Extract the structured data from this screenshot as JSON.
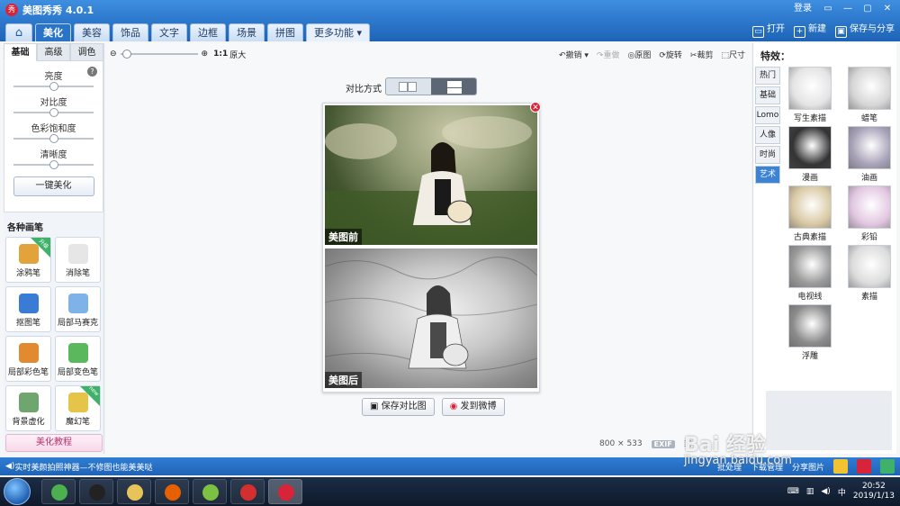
{
  "window": {
    "title": "美图秀秀 4.0.1",
    "login": "登录",
    "controls": [
      "▭",
      "—",
      "▢",
      "✕"
    ]
  },
  "tabs": [
    {
      "label": "⌂",
      "kind": "home"
    },
    {
      "label": "美化",
      "active": true
    },
    {
      "label": "美容"
    },
    {
      "label": "饰品"
    },
    {
      "label": "文字"
    },
    {
      "label": "边框"
    },
    {
      "label": "场景"
    },
    {
      "label": "拼图"
    },
    {
      "label": "更多功能 ▾"
    }
  ],
  "top_tools": {
    "open": "打开",
    "new": "新建",
    "save_share": "保存与分享"
  },
  "left": {
    "subtabs": [
      "基础",
      "高级",
      "调色"
    ],
    "sliders": [
      {
        "label": "亮度",
        "value": 0.5
      },
      {
        "label": "对比度",
        "value": 0.5
      },
      {
        "label": "色彩饱和度",
        "value": 0.5
      },
      {
        "label": "清晰度",
        "value": 0.5
      }
    ],
    "one_click": "一键美化",
    "brush_title": "各种画笔",
    "brushes": [
      {
        "label": "涂鸦笔",
        "badge": "升级",
        "color": "#e2a33a"
      },
      {
        "label": "消除笔",
        "color": "#e6e6e6"
      },
      {
        "label": "抠图笔",
        "color": "#3a7bd5"
      },
      {
        "label": "局部马赛克",
        "color": "#7fb3e8"
      },
      {
        "label": "局部彩色笔",
        "color": "#e28a2f"
      },
      {
        "label": "局部变色笔",
        "color": "#5cb85c"
      },
      {
        "label": "背景虚化",
        "color": "#6fa56f"
      },
      {
        "label": "魔幻笔",
        "badge": "new",
        "color": "#e5c44a"
      }
    ],
    "tutorial": "美化教程"
  },
  "center": {
    "zoom_1to1": "1:1",
    "zoom_original": "原大",
    "undo": "撤销",
    "redo": "重做",
    "original": "原图",
    "rotate": "旋转",
    "crop": "裁剪",
    "size": "尺寸",
    "compare_label": "对比方式",
    "before_label": "美图前",
    "after_label": "美图后",
    "save_compare": "保存对比图",
    "send_weibo": "发到微博",
    "image_width": "800",
    "image_height": "533",
    "exif": "EXIF"
  },
  "right": {
    "title": "特效：",
    "categories": [
      {
        "label": "热门"
      },
      {
        "label": "基础"
      },
      {
        "label": "Lomo"
      },
      {
        "label": "人像"
      },
      {
        "label": "时尚"
      },
      {
        "label": "艺术",
        "active": true
      }
    ],
    "effects": [
      {
        "label": "写生素描",
        "tone": "#e4e4e4"
      },
      {
        "label": "蜡笔",
        "tone": "#d6d6d6"
      },
      {
        "label": "漫画",
        "tone": "#333333"
      },
      {
        "label": "油画",
        "tone": "#a8a2b8"
      },
      {
        "label": "古典素描",
        "tone": "#d9c9a4"
      },
      {
        "label": "彩铅",
        "tone": "#e3c7e2"
      },
      {
        "label": "电视线",
        "tone": "#9a9a9a"
      },
      {
        "label": "素描",
        "tone": "#dcdcdc"
      },
      {
        "label": "浮雕",
        "tone": "#8b8b8b"
      }
    ]
  },
  "status": {
    "marquee": "实时美颜拍照神器—不修图也能美美哒",
    "batch": "批处理",
    "download": "下载管理",
    "share": "分享图片"
  },
  "taskbar": {
    "apps": [
      {
        "name": "browser-360",
        "color": "#4caf50"
      },
      {
        "name": "qq",
        "color": "#222222"
      },
      {
        "name": "file-explorer",
        "color": "#e8c35a"
      },
      {
        "name": "firefox",
        "color": "#e66000"
      },
      {
        "name": "video-player",
        "color": "#7cc242"
      },
      {
        "name": "screen-recorder",
        "color": "#d32f2f"
      },
      {
        "name": "meitu",
        "color": "#d8243a",
        "active": true
      }
    ],
    "time": "20:52",
    "date": "2019/1/13"
  },
  "watermark": {
    "brand": "Bai 经验",
    "url": "jingyan.baidu.com"
  }
}
